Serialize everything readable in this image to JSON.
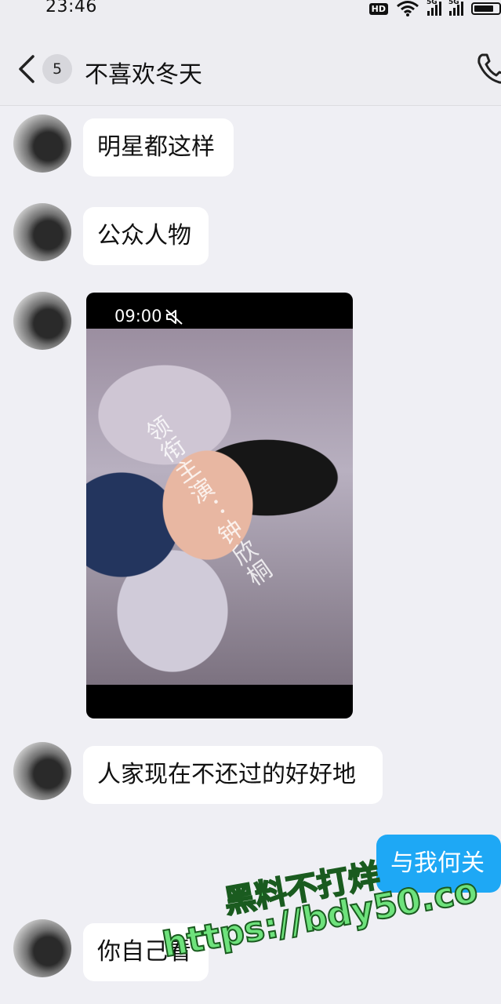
{
  "status_bar": {
    "time": "23:46",
    "hd_label": "HD",
    "network1": "5G",
    "network2": "5G"
  },
  "header": {
    "unread_count": "5",
    "title": "不喜欢冬天"
  },
  "messages": [
    {
      "sender": "other",
      "text": "明星都这样"
    },
    {
      "sender": "other",
      "text": "公众人物"
    },
    {
      "sender": "other",
      "type": "video",
      "duration": "09:00",
      "overlay_text": "领衔主演：钟欣桐"
    },
    {
      "sender": "other",
      "text": "人家现在不还过的好好地"
    },
    {
      "sender": "me",
      "text": "与我何关"
    },
    {
      "sender": "other",
      "text": "你自己看"
    }
  ],
  "watermark": {
    "line1": "黑料不打烊",
    "line2": "https://bdy50.co"
  },
  "colors": {
    "background": "#efeff4",
    "my_bubble": "#1ea8f5",
    "other_bubble": "#ffffff",
    "watermark": "#6ee27c"
  },
  "icons": [
    "back-chevron-icon",
    "phone-icon",
    "mute-icon",
    "wifi-icon",
    "signal-icon",
    "battery-icon"
  ]
}
